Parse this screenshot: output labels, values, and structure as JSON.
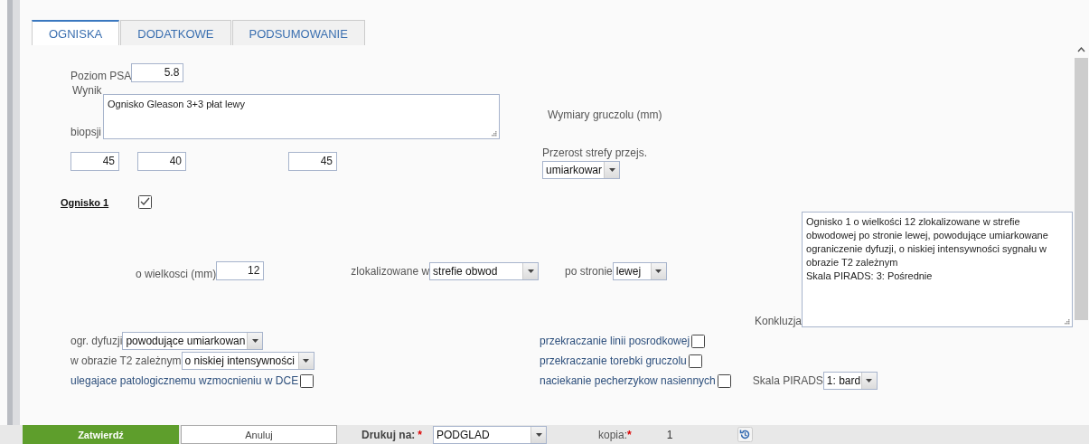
{
  "tabs": [
    {
      "label": "OGNISKA",
      "selected": true
    },
    {
      "label": "DODATKOWE",
      "selected": false
    },
    {
      "label": "PODSUMOWANIE",
      "selected": false
    }
  ],
  "psa": {
    "label": "Poziom PSA",
    "value": "5.8"
  },
  "biopsy": {
    "label_top": "Wynik",
    "label_bottom": "biopsji",
    "value": "Ognisko Gleason 3+3 płat lewy"
  },
  "gland_size": {
    "label": "Wymiary gruczolu (mm)",
    "values": [
      "45",
      "40",
      "45"
    ]
  },
  "transition_zone": {
    "label": "Przerost strefy przejs.",
    "value": "umiarkowar"
  },
  "focus": {
    "title": "Ognisko 1",
    "checked": true,
    "size": {
      "label": "o wielkosci (mm)",
      "value": "12"
    },
    "location": {
      "label": "zlokalizowane w",
      "value": "strefie obwod"
    },
    "side": {
      "label": "po stronie",
      "value": "lewej"
    },
    "diffusion": {
      "label": "ogr. dyfuzji",
      "value": "powodujące umiarkowan"
    },
    "t2": {
      "label": "w obrazie T2 zależnym",
      "value": "o niskiej intensywności"
    },
    "dce": {
      "label": "ulegajace patologicznemu wzmocnieniu w DCE",
      "checked": false
    },
    "checks": [
      {
        "label": "przekraczanie linii posrodkowej",
        "checked": false
      },
      {
        "label": "przekraczanie torebki gruczolu",
        "checked": false
      },
      {
        "label": "naciekanie pecherzykow nasiennych",
        "checked": false
      }
    ],
    "pirads": {
      "label": "Skala PIRADS",
      "value": "1: bard"
    }
  },
  "conclusion": {
    "label": "Konkluzja",
    "value": "Ognisko 1 o wielkości 12 zlokalizowane w strefie obwodowej po stronie lewej, powodujące umiarkowane ograniczenie dyfuzji, o niskiej intensywności sygnału w obrazie T2 zależnym\nSkala PIRADS: 3: Pośrednie"
  },
  "footer": {
    "confirm": "Zatwierdź",
    "cancel": "Anuluj",
    "print_label": "Drukuj na:",
    "print_required": "*",
    "print_value": "PODGLAD",
    "copies_label": "kopia:",
    "copies_required": "*",
    "copies_value": "1"
  }
}
